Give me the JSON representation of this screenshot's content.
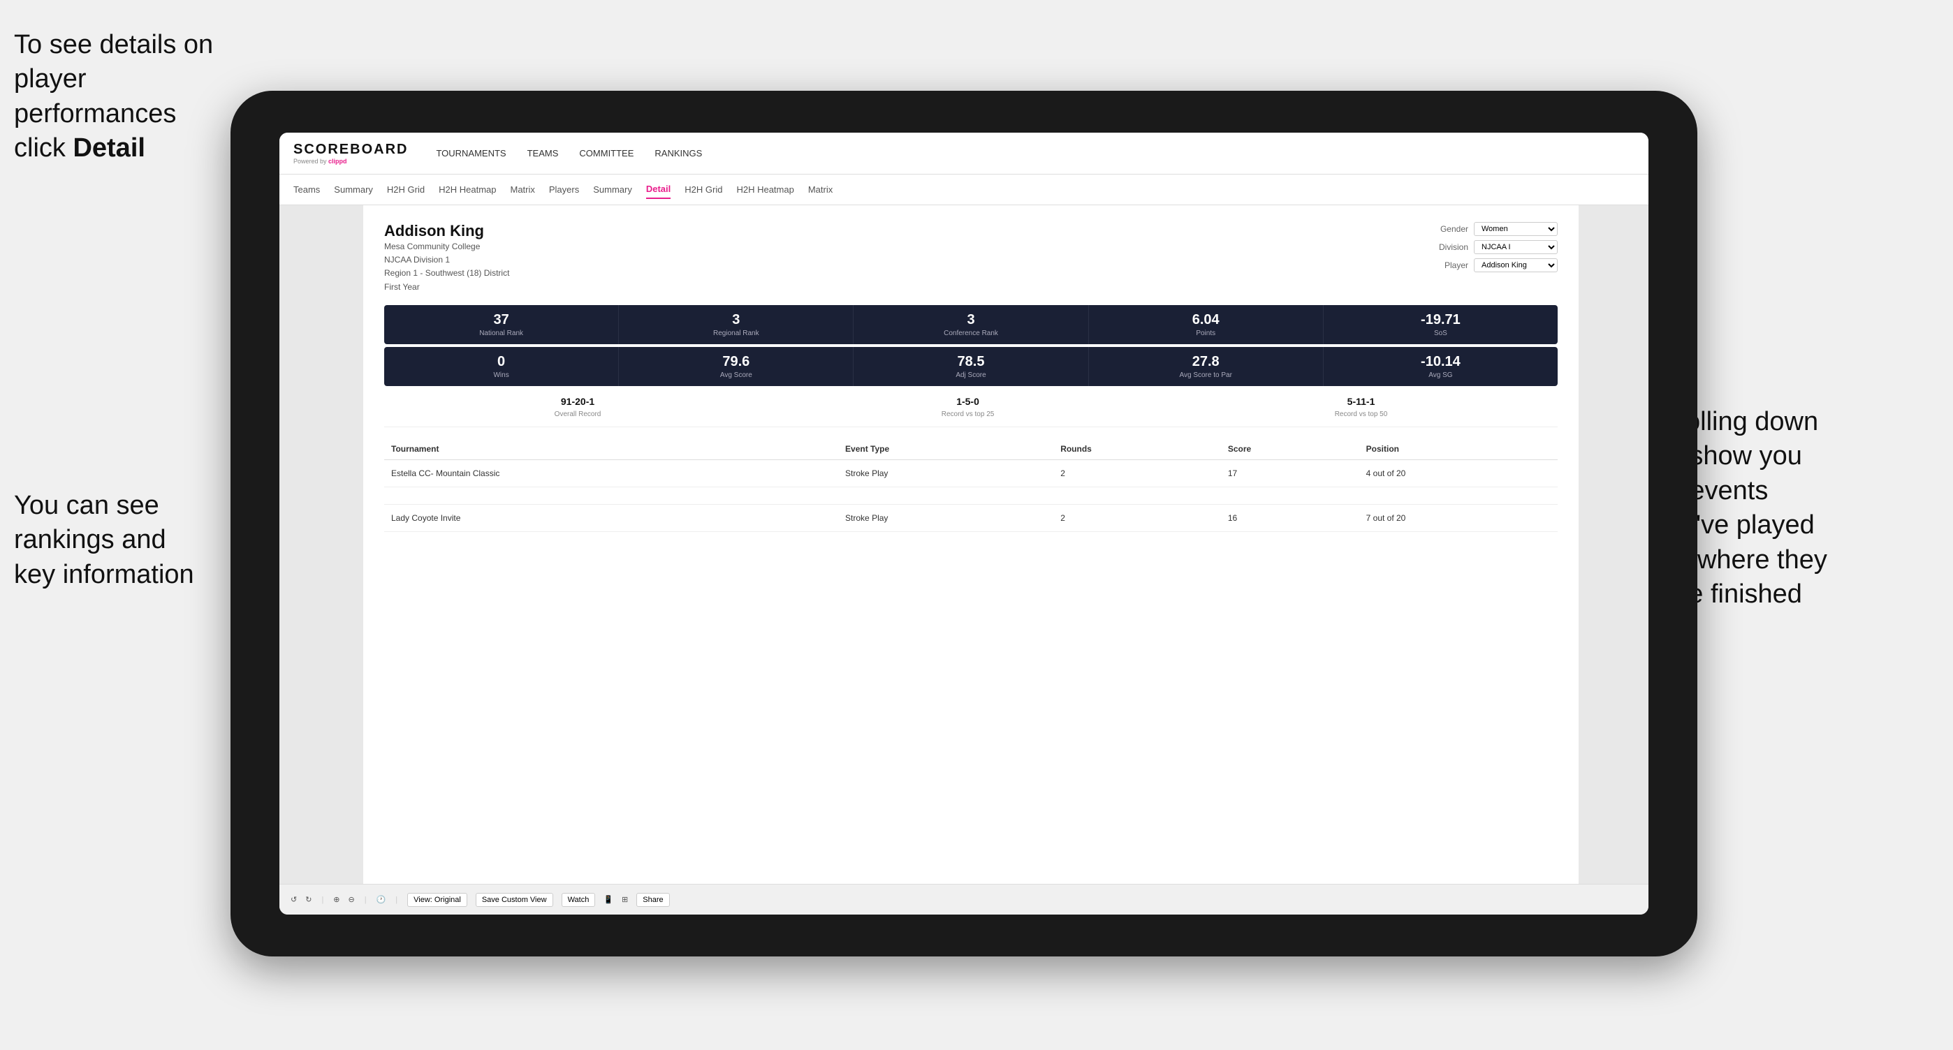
{
  "annotations": {
    "top_left": {
      "line1": "To see details on",
      "line2": "player performances",
      "line3_prefix": "click ",
      "line3_bold": "Detail"
    },
    "bottom_left": {
      "line1": "You can see",
      "line2": "rankings and",
      "line3": "key information"
    },
    "right": {
      "line1": "Scrolling down",
      "line2": "will show you",
      "line3": "the events",
      "line4": "they've played",
      "line5": "and where they",
      "line6": "have finished"
    }
  },
  "nav": {
    "logo": "SCOREBOARD",
    "powered_by": "Powered by ",
    "clippd": "clippd",
    "items": [
      "TOURNAMENTS",
      "TEAMS",
      "COMMITTEE",
      "RANKINGS"
    ]
  },
  "sub_nav": {
    "items": [
      "Teams",
      "Summary",
      "H2H Grid",
      "H2H Heatmap",
      "Matrix",
      "Players",
      "Summary",
      "Detail",
      "H2H Grid",
      "H2H Heatmap",
      "Matrix"
    ],
    "active": "Detail"
  },
  "player": {
    "name": "Addison King",
    "college": "Mesa Community College",
    "division": "NJCAA Division 1",
    "region": "Region 1 - Southwest (18) District",
    "year": "First Year",
    "gender_label": "Gender",
    "gender_value": "Women",
    "division_label": "Division",
    "division_value": "NJCAA I",
    "player_label": "Player",
    "player_value": "Addison King"
  },
  "stats_row1": [
    {
      "value": "37",
      "label": "National Rank"
    },
    {
      "value": "3",
      "label": "Regional Rank"
    },
    {
      "value": "3",
      "label": "Conference Rank"
    },
    {
      "value": "6.04",
      "label": "Points"
    },
    {
      "value": "-19.71",
      "label": "SoS"
    }
  ],
  "stats_row2": [
    {
      "value": "0",
      "label": "Wins"
    },
    {
      "value": "79.6",
      "label": "Avg Score"
    },
    {
      "value": "78.5",
      "label": "Adj Score"
    },
    {
      "value": "27.8",
      "label": "Avg Score to Par"
    },
    {
      "value": "-10.14",
      "label": "Avg SG"
    }
  ],
  "records": [
    {
      "value": "91-20-1",
      "label": "Overall Record"
    },
    {
      "value": "1-5-0",
      "label": "Record vs top 25"
    },
    {
      "value": "5-11-1",
      "label": "Record vs top 50"
    }
  ],
  "table": {
    "headers": [
      "Tournament",
      "Event Type",
      "Rounds",
      "Score",
      "Position"
    ],
    "rows": [
      {
        "tournament": "Estella CC- Mountain Classic",
        "event_type": "Stroke Play",
        "rounds": "2",
        "score": "17",
        "position": "4 out of 20"
      },
      {
        "tournament": "",
        "event_type": "",
        "rounds": "",
        "score": "",
        "position": ""
      },
      {
        "tournament": "Lady Coyote Invite",
        "event_type": "Stroke Play",
        "rounds": "2",
        "score": "16",
        "position": "7 out of 20"
      }
    ]
  },
  "toolbar": {
    "view_original": "View: Original",
    "save_custom": "Save Custom View",
    "watch": "Watch",
    "share": "Share"
  }
}
